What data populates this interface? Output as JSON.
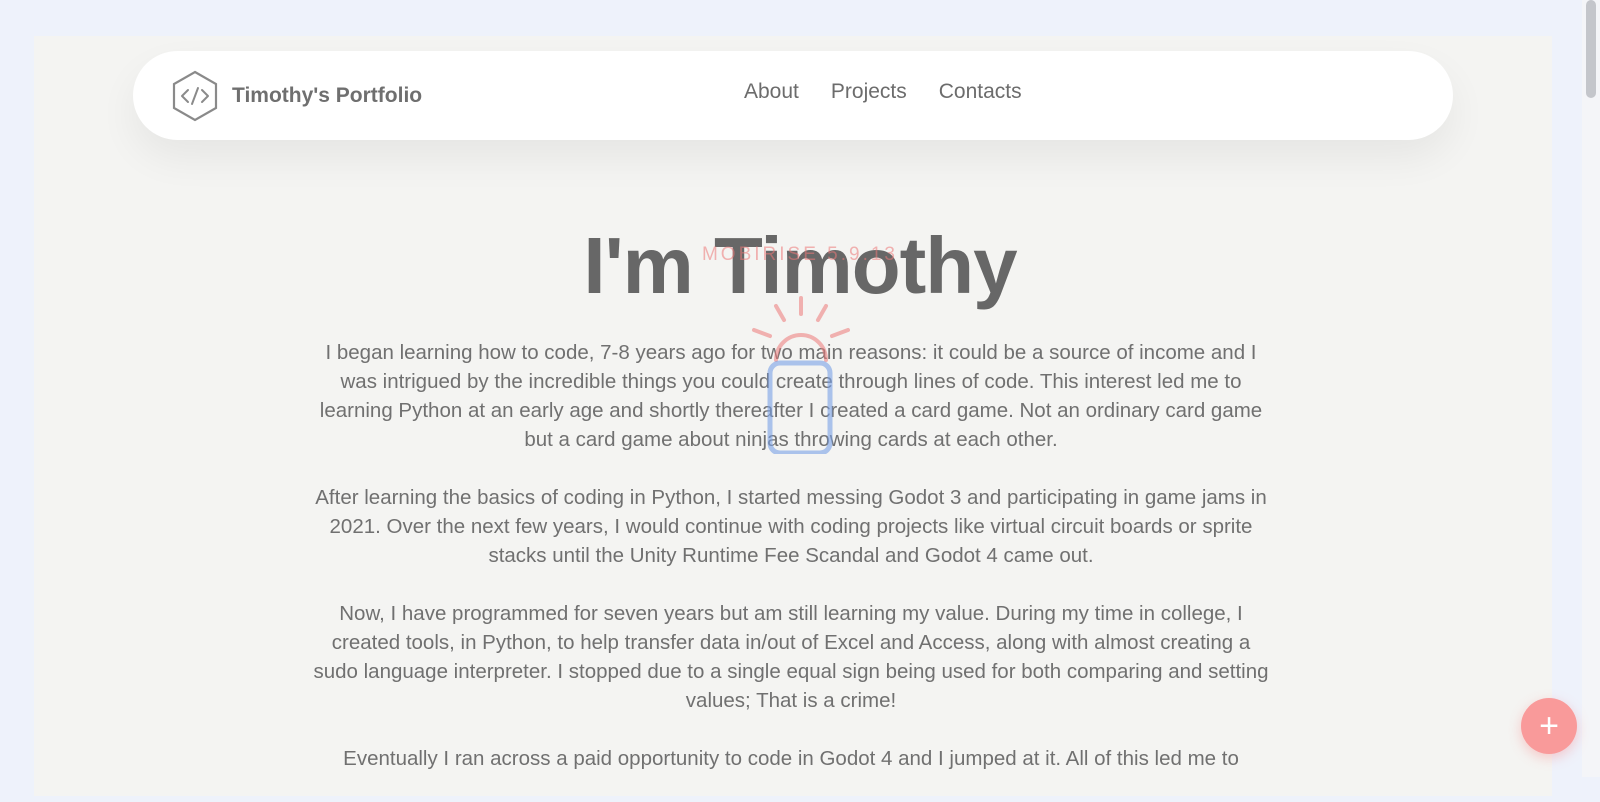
{
  "brand": {
    "name": "Timothy's Portfolio",
    "logo_icon": "code-hexagon-icon"
  },
  "nav": {
    "items": [
      {
        "label": "About"
      },
      {
        "label": "Projects"
      },
      {
        "label": "Contacts"
      }
    ]
  },
  "hero": {
    "title": "I'm Timothy",
    "paragraphs": [
      "I began learning how to code, 7-8 years ago for two main reasons: it could be a source of income and I was intrigued by the incredible things you could create through lines of code. This interest led me to learning Python at an early age and shortly thereafter I created a card game. Not an ordinary card game but a card game about ninjas throwing cards at each other.",
      "After learning the basics of coding in Python, I started messing Godot 3 and participating in game jams in 2021. Over the next few years, I would continue with coding projects like virtual circuit boards or sprite stacks until the Unity Runtime Fee Scandal and Godot 4 came out.",
      "Now, I have programmed for seven years but am still learning my value. During my time in college, I created tools, in Python, to help transfer data in/out of Excel and Access, along with almost creating a sudo language interpreter. I stopped due to a single equal sign being used for both comparing and setting values; That is a crime!",
      "Eventually I ran across a paid opportunity to code in Godot 4 and I jumped at it. All of this led me to"
    ]
  },
  "watermark": {
    "text": "MOBIRISE 5.9.13",
    "icon": "mouse-click-icon"
  },
  "fab": {
    "label": "+",
    "icon": "plus-icon"
  },
  "colors": {
    "page_bg": "#f4f4f2",
    "outer_bg": "#eef2fb",
    "title": "#676767",
    "text": "#707070",
    "fab": "#f99a9a",
    "watermark": "#ec7878"
  }
}
